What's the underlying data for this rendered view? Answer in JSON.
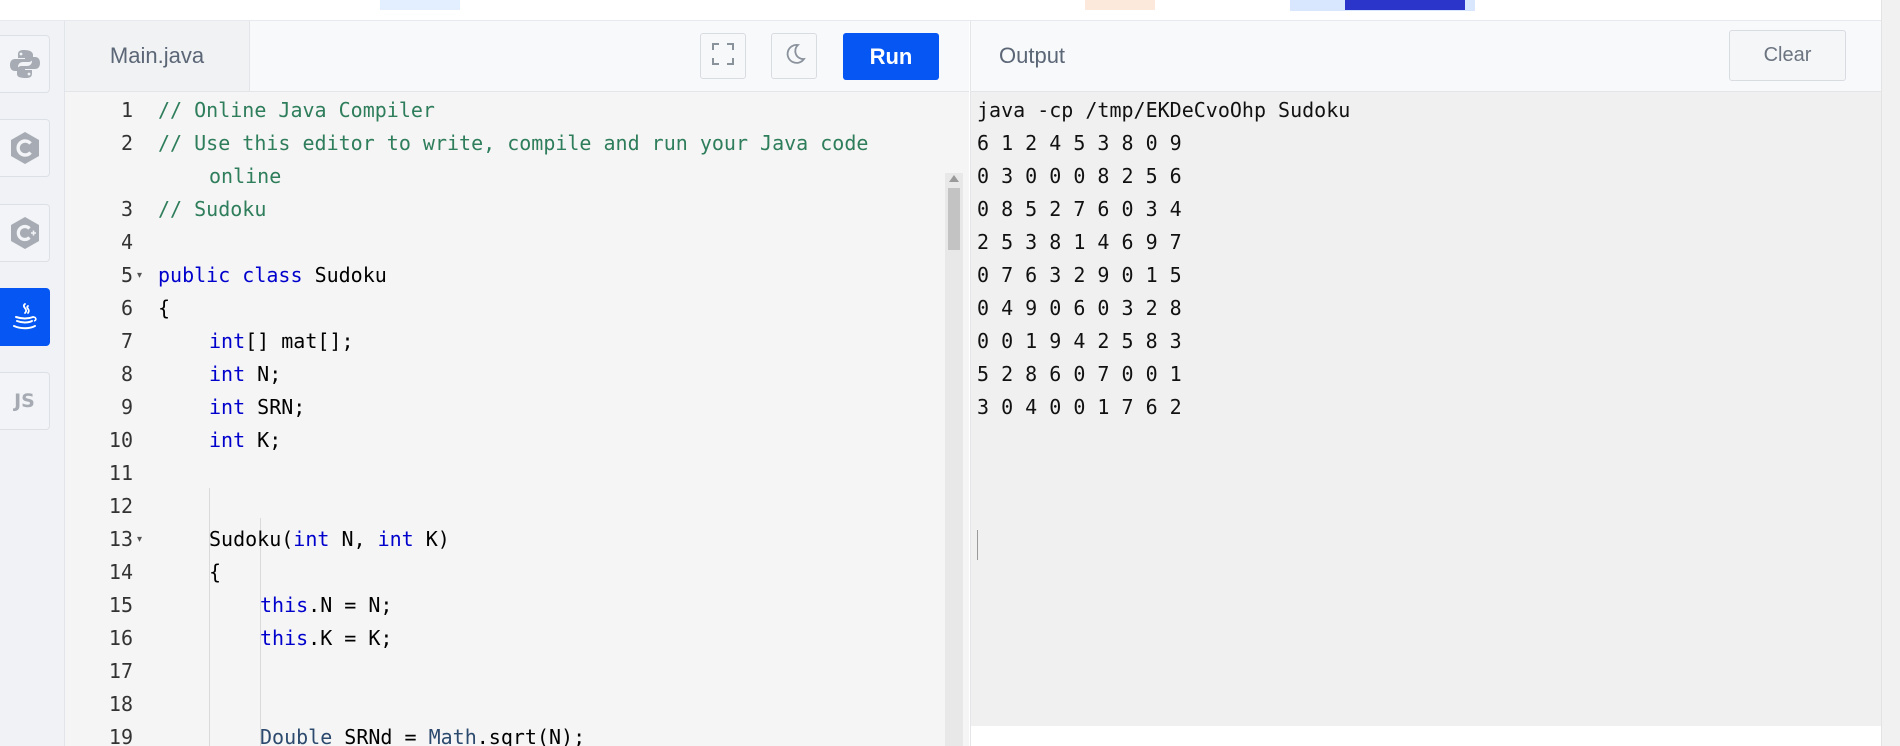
{
  "editor": {
    "tab_label": "Main.java",
    "run_label": "Run",
    "code_lines": [
      {
        "num": "1"
      },
      {
        "num": "2"
      },
      {
        "num": ""
      },
      {
        "num": "3"
      },
      {
        "num": "4"
      },
      {
        "num": "5"
      },
      {
        "num": "6"
      },
      {
        "num": "7"
      },
      {
        "num": "8"
      },
      {
        "num": "9"
      },
      {
        "num": "10"
      },
      {
        "num": "11"
      },
      {
        "num": "12"
      },
      {
        "num": "13"
      },
      {
        "num": "14"
      },
      {
        "num": "15"
      },
      {
        "num": "16"
      },
      {
        "num": "17"
      },
      {
        "num": "18"
      },
      {
        "num": "19"
      }
    ],
    "code": {
      "l1": "// Online Java Compiler",
      "l2": "// Use this editor to write, compile and run your Java code",
      "l2b": "online",
      "l3": "// Sudoku",
      "l5_kw1": "public",
      "l5_kw2": "class",
      "l5_name": "Sudoku",
      "l6": "{",
      "l7_type": "int",
      "l7_rest": "[] mat[];",
      "l8_type": "int",
      "l8_rest": " N;",
      "l9_type": "int",
      "l9_rest": " SRN;",
      "l10_type": "int",
      "l10_rest": " K;",
      "l13_name": "Sudoku(",
      "l13_t1": "int",
      "l13_mid": " N, ",
      "l13_t2": "int",
      "l13_end": " K)",
      "l14": "{",
      "l15_kw": "this",
      "l15_rest": ".N = N;",
      "l16_kw": "this",
      "l16_rest": ".K = K;",
      "l19_type": "Double",
      "l19_mid": " SRNd = ",
      "l19_cls": "Math",
      "l19_end": ".sqrt(N);"
    }
  },
  "output": {
    "title": "Output",
    "clear_label": "Clear",
    "lines": [
      "java -cp /tmp/EKDeCvoOhp Sudoku",
      "6 1 2 4 5 3 8 0 9",
      "0 3 0 0 0 8 2 5 6",
      "0 8 5 2 7 6 0 3 4",
      "2 5 3 8 1 4 6 9 7",
      "0 7 6 3 2 9 0 1 5",
      "0 4 9 0 6 0 3 2 8",
      "0 0 1 9 4 2 5 8 3",
      "5 2 8 6 0 7 0 0 1",
      "3 0 4 0 0 1 7 6 2"
    ]
  },
  "sidebar": {
    "languages": [
      {
        "icon": "python-icon"
      },
      {
        "icon": "c-icon"
      },
      {
        "icon": "cpp-icon"
      },
      {
        "icon": "java-icon",
        "active": true
      },
      {
        "icon": "javascript-icon",
        "label": "JS"
      }
    ]
  },
  "colors": {
    "accent": "#0556f3",
    "comment": "#2e7d5b",
    "keyword": "#0000cd"
  }
}
